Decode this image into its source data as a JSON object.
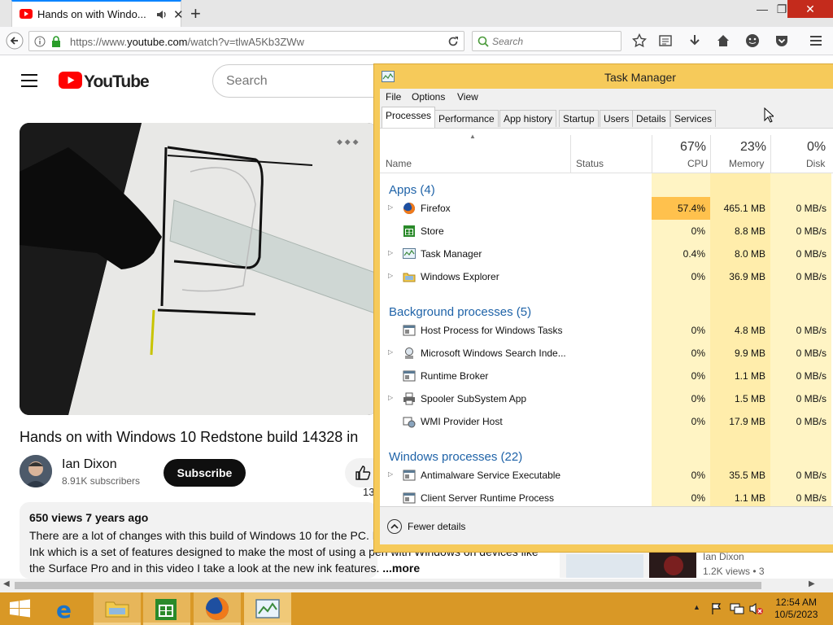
{
  "browser": {
    "tab_title": "Hands on with Windo...",
    "url_prefix": "https://www.",
    "url_domain": "youtube.com",
    "url_path": "/watch?v=tlwA5Kb3ZWw",
    "search_placeholder": "Search"
  },
  "youtube": {
    "logo_text": "YouTube",
    "search_placeholder": "Search",
    "video_title": "Hands on with Windows 10 Redstone build 14328 in",
    "channel_name": "Ian Dixon",
    "subscriber_count": "8.91K subscribers",
    "subscribe_label": "Subscribe",
    "like_count": "13",
    "description_meta": "650 views  7 years ago",
    "description_line1": "There are a lot of changes with this build of Windows 10 for the PC. B",
    "description_line2": "Ink which is a set of features designed to make the most of using a pen with Windows on devices like",
    "description_line3": "the Surface Pro and in this video I take a look at the new ink features. ",
    "description_more": "...more",
    "recommended": {
      "channel": "Ian Dixon",
      "views": "1.2K views • 3"
    }
  },
  "task_manager": {
    "title": "Task Manager",
    "menu": [
      "File",
      "Options",
      "View"
    ],
    "tabs": [
      "Processes",
      "Performance",
      "App history",
      "Startup",
      "Users",
      "Details",
      "Services"
    ],
    "columns": {
      "name": "Name",
      "status": "Status",
      "cpu_pct": "67%",
      "cpu": "CPU",
      "mem_pct": "23%",
      "mem": "Memory",
      "disk_pct": "0%",
      "disk": "Disk"
    },
    "groups": [
      {
        "name": "Apps (4)"
      },
      {
        "name": "Background processes (5)"
      },
      {
        "name": "Windows processes (22)"
      }
    ],
    "processes": [
      {
        "name": "Firefox",
        "cpu": "57.4%",
        "mem": "465.1 MB",
        "disk": "0 MB/s"
      },
      {
        "name": "Store",
        "cpu": "0%",
        "mem": "8.8 MB",
        "disk": "0 MB/s"
      },
      {
        "name": "Task Manager",
        "cpu": "0.4%",
        "mem": "8.0 MB",
        "disk": "0 MB/s"
      },
      {
        "name": "Windows Explorer",
        "cpu": "0%",
        "mem": "36.9 MB",
        "disk": "0 MB/s"
      },
      {
        "name": "Host Process for Windows Tasks",
        "cpu": "0%",
        "mem": "4.8 MB",
        "disk": "0 MB/s"
      },
      {
        "name": "Microsoft Windows Search Inde...",
        "cpu": "0%",
        "mem": "9.9 MB",
        "disk": "0 MB/s"
      },
      {
        "name": "Runtime Broker",
        "cpu": "0%",
        "mem": "1.1 MB",
        "disk": "0 MB/s"
      },
      {
        "name": "Spooler SubSystem App",
        "cpu": "0%",
        "mem": "1.5 MB",
        "disk": "0 MB/s"
      },
      {
        "name": "WMI Provider Host",
        "cpu": "0%",
        "mem": "17.9 MB",
        "disk": "0 MB/s"
      },
      {
        "name": "Antimalware Service Executable",
        "cpu": "0%",
        "mem": "35.5 MB",
        "disk": "0 MB/s"
      },
      {
        "name": "Client Server Runtime Process",
        "cpu": "0%",
        "mem": "1.1 MB",
        "disk": "0 MB/s"
      }
    ],
    "fewer_details": "Fewer details",
    "colors": {
      "frame": "#f6ca5a",
      "cpu_heavy": "#ffc14d",
      "cell_light": "#fff4c4",
      "group_text": "#1f63a8"
    }
  },
  "taskbar": {
    "time": "12:54 AM",
    "date": "10/5/2023",
    "color": "#d99826"
  }
}
